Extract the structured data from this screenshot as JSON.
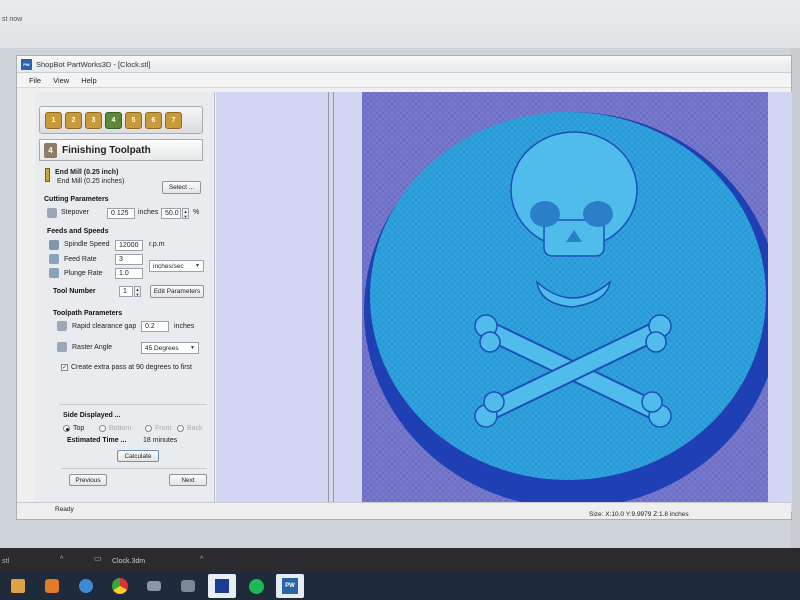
{
  "notification_fragment": "st now",
  "window": {
    "title": "ShopBot PartWorks3D - [Clock.stl]",
    "app_icon_text": "PW3D"
  },
  "menu": [
    "File",
    "View",
    "Help"
  ],
  "strategy_steps": [
    "1",
    "2",
    "3",
    "4",
    "5",
    "6",
    "7"
  ],
  "panel": {
    "number": "4",
    "title": "Finishing Toolpath"
  },
  "tool": {
    "name": "End Mill (0.25 inch)",
    "subname": "End Mill (0.25 inches)",
    "select_label": "Select ..."
  },
  "cutting": {
    "heading": "Cutting Parameters",
    "stepover_label": "Stepover",
    "stepover_value": "0.125",
    "stepover_unit": "inches",
    "stepover_percent": "50.0",
    "percent_symbol": "%"
  },
  "feeds": {
    "heading": "Feeds and Speeds",
    "spindle_label": "Spindle Speed",
    "spindle_value": "12000",
    "spindle_unit": "r.p.m",
    "feed_label": "Feed Rate",
    "feed_value": "3",
    "plunge_label": "Plunge Rate",
    "plunge_value": "1.0",
    "rate_unit": "inches/sec",
    "tool_number_label": "Tool Number",
    "tool_number_value": "1",
    "edit_params_label": "Edit Parameters"
  },
  "toolpath": {
    "heading": "Toolpath Parameters",
    "clearance_label": "Rapid clearance gap",
    "clearance_value": "0.2",
    "clearance_unit": "inches",
    "raster_label": "Raster Angle",
    "raster_value": "45 Degrees",
    "extra_pass_label": "Create extra pass at 90 degrees to first",
    "extra_pass_checked": true
  },
  "side": {
    "heading": "Side Displayed ...",
    "options": [
      "Top",
      "Bottom",
      "Front",
      "Back"
    ],
    "selected": "Top",
    "estimated_label": "Estimated Time ...",
    "estimated_value": "18 minutes",
    "calculate_label": "Calculate"
  },
  "nav": {
    "previous_label": "Previous",
    "next_label": "Next"
  },
  "status": {
    "left": "Ready",
    "right": "Size: X:10.0 Y:9.9979 Z:1.8 inches"
  },
  "downloads": [
    {
      "name": "stl"
    },
    {
      "name": "Clock.3dm"
    }
  ],
  "taskbar_icons": [
    "windows-start-icon",
    "media-player-icon",
    "internet-explorer-icon",
    "chrome-icon",
    "game-icon",
    "settings-icon",
    "cad-icon",
    "spotify-icon",
    "partworks3d-icon"
  ],
  "colors": {
    "view_background": "#d2d6f2",
    "model_fill": "#2fa3dc",
    "model_shadow": "#1f3fb4",
    "toolpath_mesh": "#2a4fd0"
  }
}
